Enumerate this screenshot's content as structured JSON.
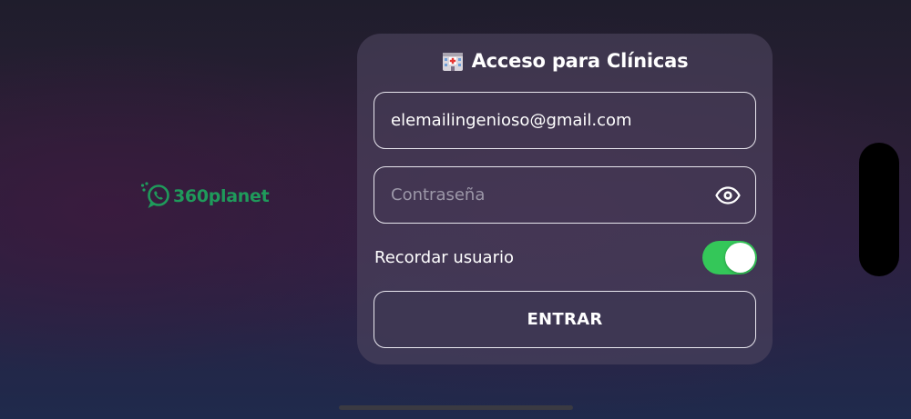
{
  "logo": {
    "text": "360planet",
    "icon": "whatsapp-chat-icon",
    "color": "#1f9a5b"
  },
  "login_card": {
    "title": "Acceso para Clínicas",
    "title_icon": "hospital-icon",
    "email": {
      "value": "elemailingenioso@gmail.com"
    },
    "password": {
      "value": "",
      "placeholder": "Contraseña",
      "toggle_icon": "eye-icon"
    },
    "remember": {
      "label": "Recordar usuario",
      "checked": true,
      "on_color": "#34c759"
    },
    "submit": {
      "label": "ENTRAR"
    }
  }
}
